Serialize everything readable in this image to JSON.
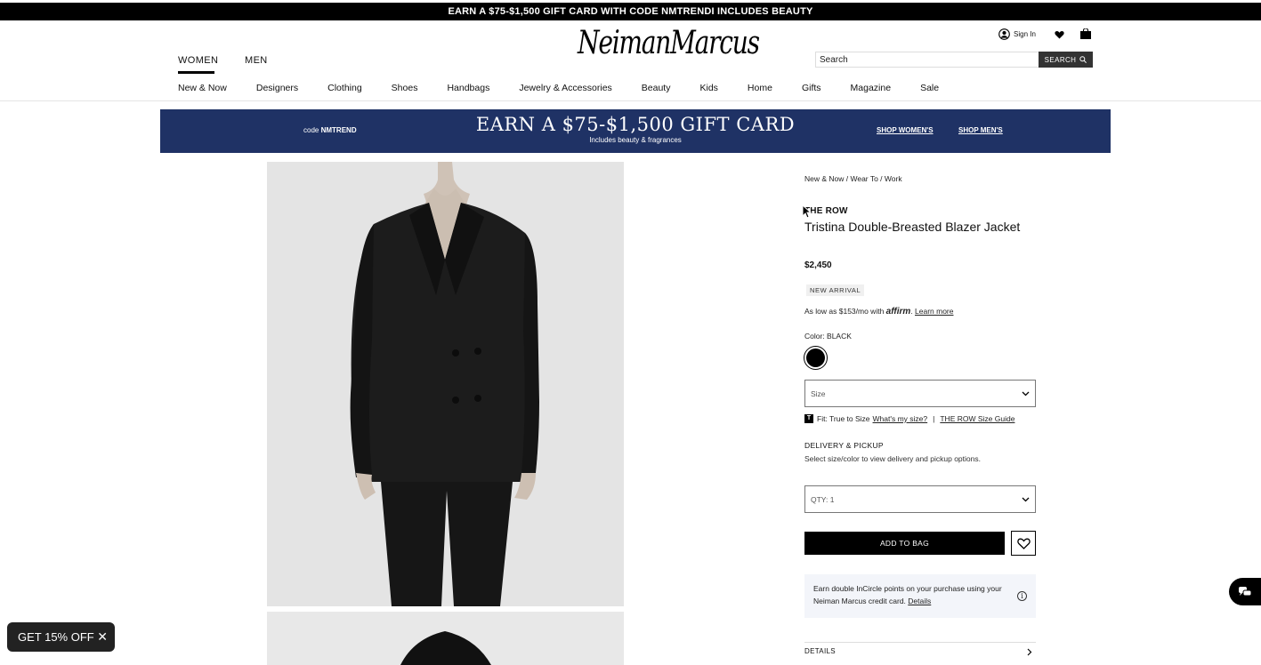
{
  "promo_bar": {
    "text": "EARN A $75-$1,500 GIFT CARD WITH CODE NMTRENDI INCLUDES BEAUTY"
  },
  "header": {
    "logo": "NeimanMarcus",
    "gender_tabs": [
      {
        "label": "WOMEN",
        "active": true
      },
      {
        "label": "MEN",
        "active": false
      }
    ],
    "sign_in": "Sign In",
    "search": {
      "placeholder": "Search",
      "button": "SEARCH"
    }
  },
  "category_nav": [
    "New & Now",
    "Designers",
    "Clothing",
    "Shoes",
    "Handbags",
    "Jewelry & Accessories",
    "Beauty",
    "Kids",
    "Home",
    "Gifts",
    "Magazine",
    "Sale"
  ],
  "banner": {
    "code_prefix": "code",
    "code": "NMTREND",
    "headline": "EARN A $75-$1,500 GIFT CARD",
    "sub": "Includes beauty & fragrances",
    "shop_womens": "SHOP WOMEN'S",
    "shop_mens": "SHOP MEN'S",
    "bg_color": "#1f3265"
  },
  "product": {
    "breadcrumb": "New & Now / Wear To / Work",
    "brand": "THE ROW",
    "name": "Tristina Double-Breasted Blazer Jacket",
    "price": "$2,450",
    "badge": "NEW ARRIVAL",
    "affirm_prefix": "As low as $153/mo with",
    "affirm_logo": "affirm",
    "affirm_link": "Learn more",
    "color_label": "Color: BLACK",
    "size_select": "Size",
    "fit_icon": "T",
    "fit_text": "Fit: True to Size",
    "fit_link": "What's my size?",
    "fit_sep": "|",
    "size_guide": "THE ROW Size Guide",
    "delivery_title": "DELIVERY & PICKUP",
    "delivery_text": "Select size/color to view delivery and pickup options.",
    "qty_select": "QTY: 1",
    "add_to_bag": "ADD TO BAG",
    "incircle_text": "Earn double InCircle points on your purchase using your Neiman Marcus credit card.",
    "incircle_link": "Details",
    "details_label": "DETAILS"
  },
  "discount_tab": {
    "label": "GET 15% OFF"
  },
  "icons": {
    "user": "user-icon",
    "heart": "heart-icon",
    "bag": "shopping-bag-icon",
    "search": "search-icon",
    "chevron": "chevron-down-icon",
    "chat": "chat-icon",
    "close": "close-icon",
    "info": "info-icon"
  }
}
